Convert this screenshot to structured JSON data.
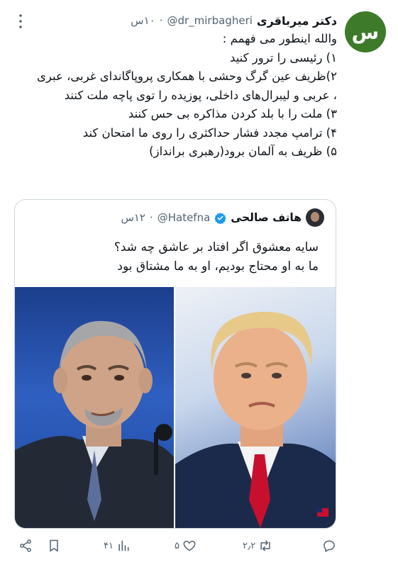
{
  "tweet": {
    "avatar_letter": "س",
    "avatar_color": "#3d7a2a",
    "author_name": "دکتر میرباقری",
    "handle": "@dr_mirbagheri",
    "separator": "·",
    "time": "۱۰س",
    "lines": [
      "والله اینطور می فهمم :",
      "۱) رئیسی را ترور کنید",
      "۲)ظریف عین گرگ وحشی با همکاری پروپاگاندای غربی، عبری ، عربی و لیبرال‌های داخلی، پوزیده را توی پاچه ملت کنند",
      "۳) ملت را با بلد کردن مذاکره بی حس کنند",
      "۴) ترامپ مجدد فشار حداکثری را روی ما امتحان کند",
      "۵) ظریف به آلمان برود(رهبری برانداز)"
    ]
  },
  "quote": {
    "author_name": "هاتف صالحی",
    "handle": "@Hatefna",
    "separator": "·",
    "time": "۱۲س",
    "verified_color": "#1d9bf0",
    "lines": [
      "سایه معشوق اگر افتاد بر عاشق چه شد؟",
      "ما به او محتاج بودیم، او به ما مشتاق بود"
    ]
  },
  "actions": {
    "replies": "",
    "retweets": "۲٫۲",
    "likes": "۵",
    "views": "۴۱",
    "icon_color": "#536471"
  }
}
